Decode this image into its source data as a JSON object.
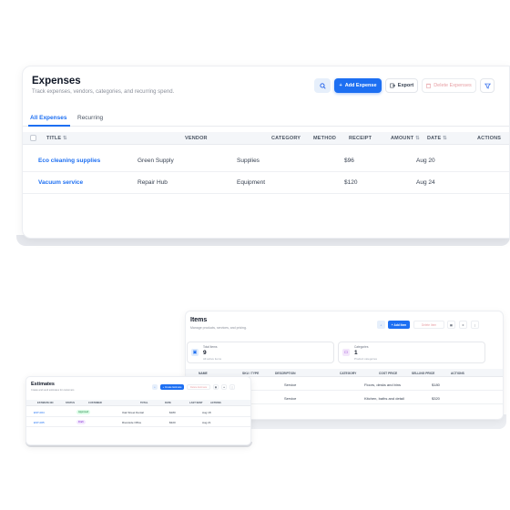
{
  "expenses": {
    "title": "Expenses",
    "subtitle": "Track expenses, vendors, categories, and recurring spend.",
    "buttons": {
      "add": "Add Expense",
      "export": "Export",
      "delete": "Delete Expenses"
    },
    "tabs": [
      "All Expenses",
      "Recurring"
    ],
    "columns": {
      "title": "TITLE",
      "vendor": "VENDOR",
      "category": "CATEGORY",
      "method": "METHOD",
      "receipt": "RECEIPT",
      "amount": "AMOUNT",
      "date": "DATE",
      "actions": "ACTIONS"
    },
    "rows": [
      {
        "title": "Eco cleaning supplies",
        "vendor": "Green Supply",
        "category": "Supplies",
        "amount": "$96",
        "date": "Aug 20"
      },
      {
        "title": "Vacuum service",
        "vendor": "Repair Hub",
        "category": "Equipment",
        "amount": "$120",
        "date": "Aug 24"
      }
    ],
    "accent": "#1d6ff2"
  },
  "items": {
    "title": "Items",
    "subtitle": "Manage products, services, and pricing.",
    "buttons": {
      "add": "Add Item",
      "delete": "Delete Item"
    },
    "stats": [
      {
        "label": "Total Items",
        "value": "9",
        "sub": "All active items"
      },
      {
        "label": "Categories",
        "value": "1",
        "sub": "Product categories"
      }
    ],
    "columns": {
      "name": "NAME",
      "sku": "SKU / TYPE",
      "description": "DESCRIPTION",
      "category": "CATEGORY",
      "cost": "COST PRICE",
      "selling": "SELLING PRICE",
      "actions": "ACTIONS"
    },
    "rows": [
      {
        "sku": "Service",
        "category": "Floors, desks and bins",
        "selling": "$180"
      },
      {
        "sku": "Service",
        "category": "Kitchen, baths and detail",
        "selling": "$320"
      }
    ]
  },
  "estimates": {
    "title": "Estimates",
    "subtitle": "Create and send estimates for customers",
    "buttons": {
      "add": "Create Estimate",
      "delete": "Delete Estimate"
    },
    "columns": {
      "number": "ESTIMATE NO",
      "status": "STATUS",
      "customer": "CUSTOMER",
      "total": "TOTAL",
      "date": "DATE",
      "expiry": "LAST SENT",
      "actions": "ACTIONS"
    },
    "rows": [
      {
        "number": "EST-004",
        "status": "Approved",
        "customer": "Oak Street Dental",
        "total": "$180",
        "date": "Aug 18"
      },
      {
        "number": "EST-005",
        "status": "Draft",
        "customer": "Riverside Office",
        "total": "$320",
        "date": "Aug 21"
      }
    ]
  }
}
